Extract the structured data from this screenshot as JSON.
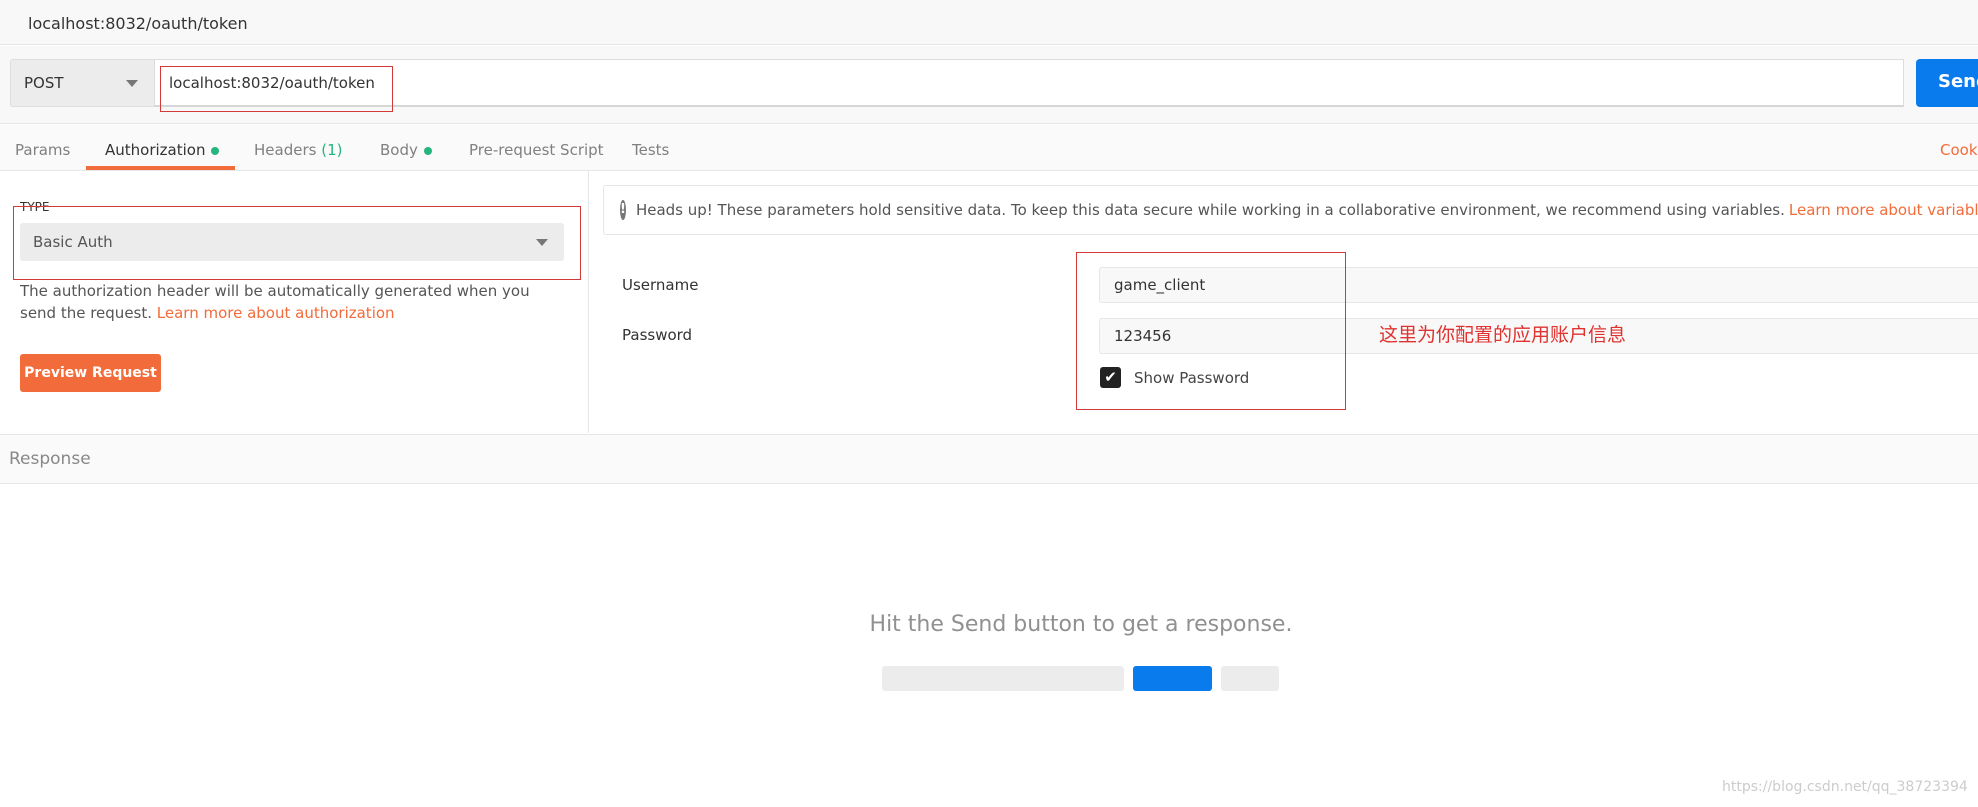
{
  "title_bar": {
    "title": "localhost:8032/oauth/token"
  },
  "request": {
    "method": "POST",
    "url": "localhost:8032/oauth/token",
    "send_label": "Send"
  },
  "tabs": [
    {
      "label": "Params"
    },
    {
      "label": "Authorization",
      "dot": true
    },
    {
      "label": "Headers",
      "count": "(1)"
    },
    {
      "label": "Body",
      "dot": true
    },
    {
      "label": "Pre-request Script"
    },
    {
      "label": "Tests"
    }
  ],
  "cookies_label": "Cooki",
  "auth": {
    "type_label": "TYPE",
    "type_value": "Basic Auth",
    "description": "The authorization header will be automatically generated when you send the request. ",
    "learn_more": "Learn more about authorization",
    "preview_button": "Preview Request"
  },
  "alert": {
    "text": "Heads up! These parameters hold sensitive data. To keep this data secure while working in a collaborative environment, we recommend using variables. ",
    "link": "Learn more about variables"
  },
  "fields": {
    "username_label": "Username",
    "username_value": "game_client",
    "password_label": "Password",
    "password_value": "123456",
    "show_password_label": "Show Password",
    "show_password_checked": true
  },
  "annotation": "这里为你配置的应用账户信息",
  "response": {
    "header": "Response",
    "empty_message": "Hit the Send button to get a response."
  },
  "watermark": "https://blog.csdn.net/qq_38723394",
  "colors": {
    "accent": "#f26b3a",
    "send": "#097bed",
    "dot": "#26b47f",
    "annotation": "#e0322f"
  }
}
